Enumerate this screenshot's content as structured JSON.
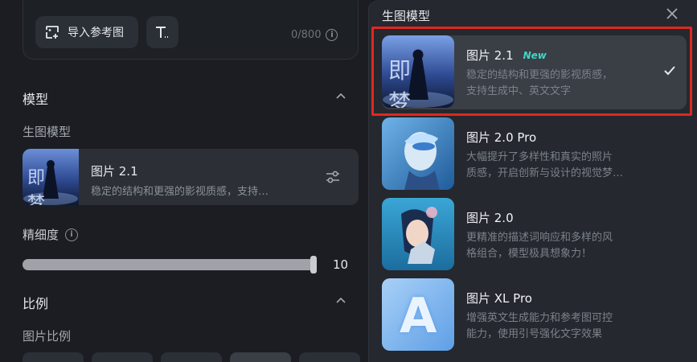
{
  "prompt_area": {
    "import_label": "导入参考图",
    "counter": "0/800"
  },
  "model_section": {
    "title": "模型",
    "sub_label": "生图模型",
    "current": {
      "thumb_text": "即梦",
      "name": "图片 2.1",
      "desc": "稳定的结构和更强的影视质感，支持…"
    }
  },
  "detail": {
    "label": "精细度",
    "value": "10",
    "level": 1.0
  },
  "ratio_section": {
    "title": "比例",
    "sub_label": "图片比例"
  },
  "popover": {
    "title": "生图模型",
    "items": [
      {
        "name": "图片 2.1",
        "badge": "New",
        "thumb_text": "即梦",
        "desc_line1": "稳定的结构和更强的影视质感，",
        "desc_line2": "支持生成中、英文文字",
        "selected": true
      },
      {
        "name": "图片 2.0 Pro",
        "desc_line1": "大幅提升了多样性和真实的照片",
        "desc_line2": "质感，开启创新与设计的视觉梦…",
        "selected": false
      },
      {
        "name": "图片 2.0",
        "desc_line1": "更精准的描述词响应和多样的风",
        "desc_line2": "格组合，模型极具想象力！",
        "selected": false
      },
      {
        "name": "图片 XL Pro",
        "thumb_text": "A",
        "desc_line1": "增强英文生成能力和参考图可控",
        "desc_line2": "能力，使用引号强化文字效果",
        "selected": false
      }
    ]
  },
  "colors": {
    "accent_new": "#3fd6c8",
    "highlight_border": "#e0281f",
    "panel_bg": "#1b1d22",
    "popover_bg": "#25282e"
  },
  "icons": [
    "image-import-icon",
    "text-format-icon",
    "info-icon",
    "chevron-up-icon",
    "settings-sliders-icon",
    "close-icon",
    "check-icon"
  ]
}
